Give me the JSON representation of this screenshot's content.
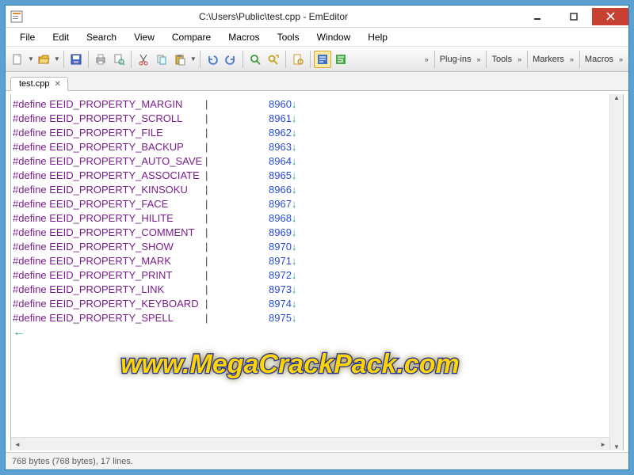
{
  "title": "C:\\Users\\Public\\test.cpp - EmEditor",
  "menu": [
    "File",
    "Edit",
    "Search",
    "View",
    "Compare",
    "Macros",
    "Tools",
    "Window",
    "Help"
  ],
  "toolbar_sections": [
    "Plug-ins",
    "Tools",
    "Markers",
    "Macros"
  ],
  "tab": {
    "label": "test.cpp"
  },
  "status": "768 bytes (768 bytes), 17 lines.",
  "watermark": "www.MegaCrackPack.com",
  "code": [
    {
      "def": "#define EEID_PROPERTY_MARGIN",
      "val": "8960"
    },
    {
      "def": "#define EEID_PROPERTY_SCROLL",
      "val": "8961"
    },
    {
      "def": "#define EEID_PROPERTY_FILE",
      "val": "8962"
    },
    {
      "def": "#define EEID_PROPERTY_BACKUP",
      "val": "8963"
    },
    {
      "def": "#define EEID_PROPERTY_AUTO_SAVE",
      "val": "8964"
    },
    {
      "def": "#define EEID_PROPERTY_ASSOCIATE",
      "val": "8965"
    },
    {
      "def": "#define EEID_PROPERTY_KINSOKU",
      "val": "8966"
    },
    {
      "def": "#define EEID_PROPERTY_FACE",
      "val": "8967"
    },
    {
      "def": "#define EEID_PROPERTY_HILITE",
      "val": "8968"
    },
    {
      "def": "#define EEID_PROPERTY_COMMENT",
      "val": "8969"
    },
    {
      "def": "#define EEID_PROPERTY_SHOW",
      "val": "8970"
    },
    {
      "def": "#define EEID_PROPERTY_MARK",
      "val": "8971"
    },
    {
      "def": "#define EEID_PROPERTY_PRINT",
      "val": "8972"
    },
    {
      "def": "#define EEID_PROPERTY_LINK",
      "val": "8973"
    },
    {
      "def": "#define EEID_PROPERTY_KEYBOARD",
      "val": "8974"
    },
    {
      "def": "#define EEID_PROPERTY_SPELL",
      "val": "8975"
    }
  ]
}
